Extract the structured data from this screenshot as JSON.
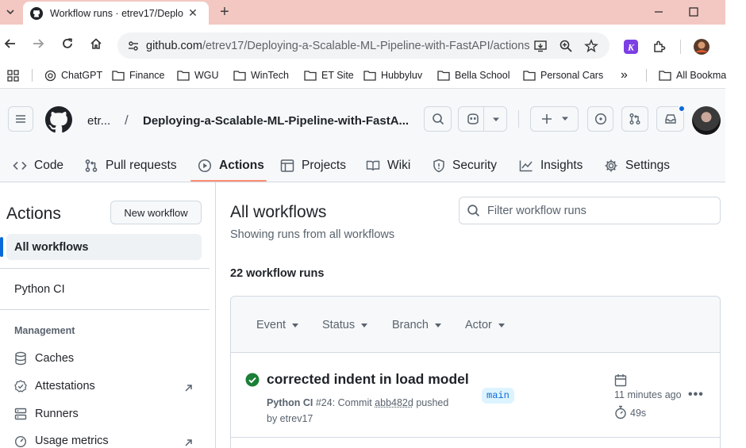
{
  "browser": {
    "tab_title": "Workflow runs · etrev17/Deploy",
    "url_host": "github.com",
    "url_path": "/etrev17/Deploying-a-Scalable-ML-Pipeline-with-FastAPI/actions",
    "bookmarks": [
      "ChatGPT",
      "Finance",
      "WGU",
      "WinTech",
      "ET Site",
      "Hubbyluv",
      "Bella School",
      "Personal Cars"
    ],
    "overflow_label": "»",
    "all_bookmarks": "All Bookma"
  },
  "github": {
    "owner": "etr...",
    "slash": "/",
    "repo": "Deploying-a-Scalable-ML-Pipeline-with-FastA...",
    "repo_nav": [
      {
        "label": "Code",
        "icon": "code-icon"
      },
      {
        "label": "Pull requests",
        "icon": "pull-request-icon"
      },
      {
        "label": "Actions",
        "icon": "play-icon",
        "active": true
      },
      {
        "label": "Projects",
        "icon": "table-icon"
      },
      {
        "label": "Wiki",
        "icon": "book-icon"
      },
      {
        "label": "Security",
        "icon": "shield-icon"
      },
      {
        "label": "Insights",
        "icon": "graph-icon"
      },
      {
        "label": "Settings",
        "icon": "gear-icon"
      }
    ],
    "accent": "#fd8c73"
  },
  "sidebar": {
    "title": "Actions",
    "new_workflow": "New workflow",
    "all_workflows": "All workflows",
    "workflow": "Python CI",
    "management_heading": "Management",
    "items": [
      {
        "label": "Caches",
        "icon": "database-icon"
      },
      {
        "label": "Attestations",
        "icon": "verified-icon",
        "external": true
      },
      {
        "label": "Runners",
        "icon": "server-icon"
      },
      {
        "label": "Usage metrics",
        "icon": "meter-icon",
        "external": true
      }
    ]
  },
  "main": {
    "title": "All workflows",
    "subtitle": "Showing runs from all workflows",
    "filter_placeholder": "Filter workflow runs",
    "run_count": "22 workflow runs",
    "filters": [
      "Event",
      "Status",
      "Branch",
      "Actor"
    ],
    "runs": [
      {
        "title": "corrected indent in load model",
        "workflow": "Python CI",
        "number": "#24",
        "commit_prefix": ": Commit",
        "sha": "abb482d",
        "action": "pushed",
        "by": "by etrev17",
        "branch": "main",
        "time": "11 minutes ago",
        "duration": "49s",
        "status": "success",
        "status_color": "#1a7f37"
      }
    ]
  }
}
